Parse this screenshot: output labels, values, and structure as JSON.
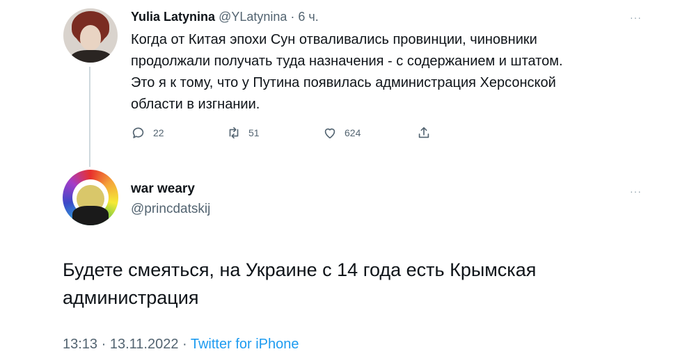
{
  "parent_tweet": {
    "name": "Yulia Latynina",
    "handle": "@YLatynina",
    "time": " · 6 ч.",
    "text": "Когда от Китая эпохи Сун отваливались провинции, чиновники\nпродолжали получать туда назначения - с содержанием и штатом.\nЭто я к тому, что у Путина появилась администрация Херсонской\nобласти в изгнании.",
    "replies": "22",
    "retweets": "51",
    "likes": "624",
    "more": "···"
  },
  "reply_tweet": {
    "name": "war weary",
    "handle": "@princdatskij",
    "more": "···",
    "text": "Будете смеяться, на Украине с 14 года есть Крымская\nадминистрация",
    "time": "13:13 · 13.11.2022 · ",
    "source": "Twitter for iPhone"
  },
  "colors": {
    "secondary": "#536471",
    "link": "#1d9bf0",
    "thread_line": "#cfd9de"
  }
}
